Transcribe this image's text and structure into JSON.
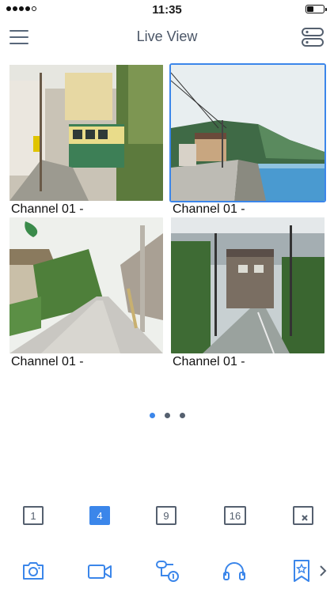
{
  "status_bar": {
    "time": "11:35",
    "signal_bars_filled": 4,
    "signal_bars_total": 5,
    "battery_level_pct": 35
  },
  "nav": {
    "title": "Live View",
    "menu_icon": "hamburger-menu-icon",
    "right_icon": "server-list-icon"
  },
  "channels": [
    {
      "label": "Channel 01 -",
      "selected": false,
      "scene": "tram-street"
    },
    {
      "label": "Channel 01 -",
      "selected": true,
      "scene": "seaside-road"
    },
    {
      "label": "Channel 01 -",
      "selected": false,
      "scene": "village-road"
    },
    {
      "label": "Channel 01 -",
      "selected": false,
      "scene": "hillside-town"
    }
  ],
  "pager": {
    "pages": 3,
    "current": 1
  },
  "layouts": [
    {
      "label": "1",
      "active": false
    },
    {
      "label": "4",
      "active": true
    },
    {
      "label": "9",
      "active": false
    },
    {
      "label": "16",
      "active": false
    },
    {
      "label": "",
      "active": false,
      "icon": "close-all-icon"
    }
  ],
  "toolbar": [
    {
      "icon": "camera-snapshot-icon"
    },
    {
      "icon": "video-record-icon"
    },
    {
      "icon": "ptz-control-icon"
    },
    {
      "icon": "headphones-audio-icon"
    },
    {
      "icon": "bookmark-star-icon"
    },
    {
      "icon": "chevron-right-icon"
    }
  ],
  "colors": {
    "accent": "#3b86ea",
    "icon": "#55606f"
  }
}
